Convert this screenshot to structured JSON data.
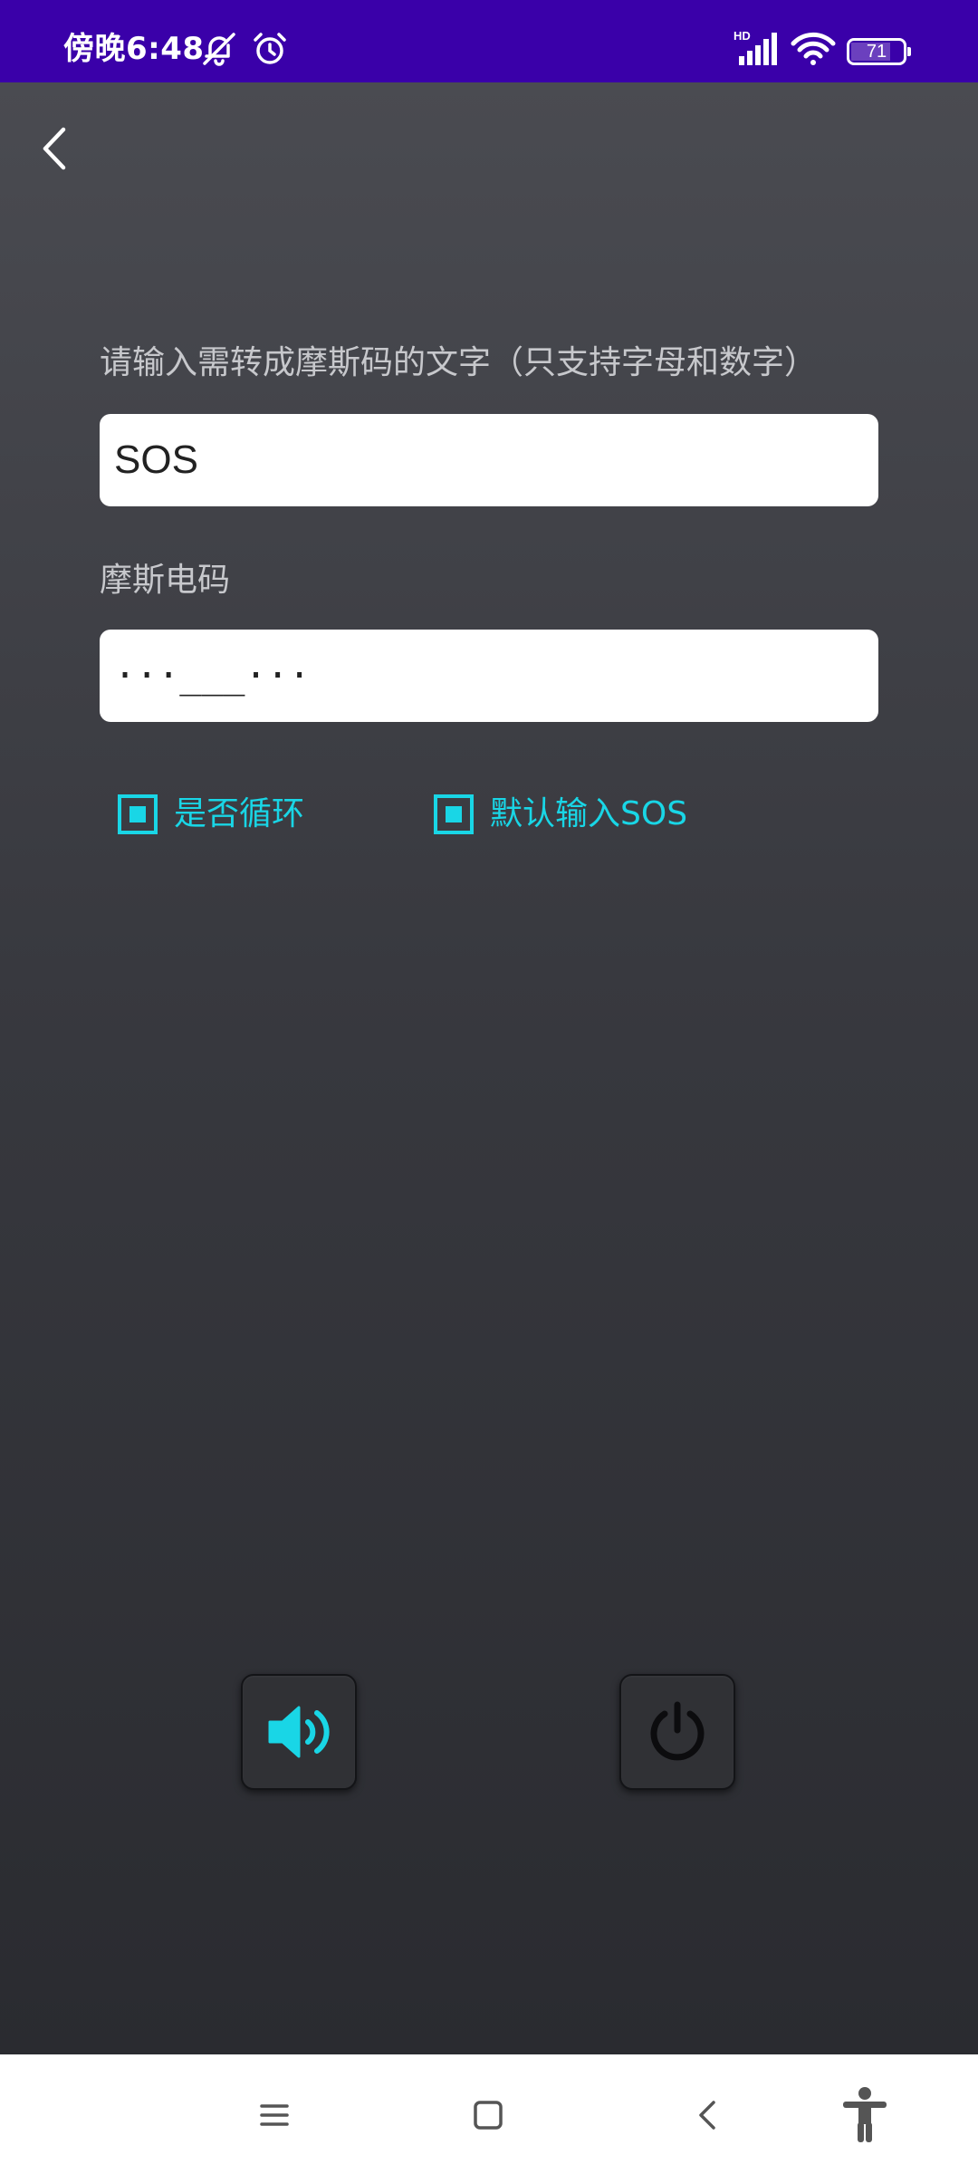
{
  "status_bar": {
    "time": "傍晚6:48",
    "battery_level": "71",
    "network_label": "HD",
    "icons": [
      "bell-off-icon",
      "alarm-icon",
      "signal-icon",
      "wifi-icon",
      "battery-icon"
    ]
  },
  "header": {
    "back_icon": "chevron-left-icon"
  },
  "form": {
    "text_label": "请输入需转成摩斯码的文字（只支持字母和数字）",
    "text_value": "SOS",
    "morse_label": "摩斯电码",
    "morse_value": "···___···"
  },
  "options": {
    "loop_label": "是否循环",
    "default_sos_label": "默认输入SOS"
  },
  "controls": {
    "sound_icon": "speaker-icon",
    "power_icon": "power-icon"
  },
  "nav_bar": {
    "icons": [
      "menu-icon",
      "home-icon",
      "back-icon",
      "accessibility-icon"
    ]
  },
  "colors": {
    "status_bar": "#3a00a9",
    "accent": "#19d6e6",
    "background": "#2d2e33"
  }
}
